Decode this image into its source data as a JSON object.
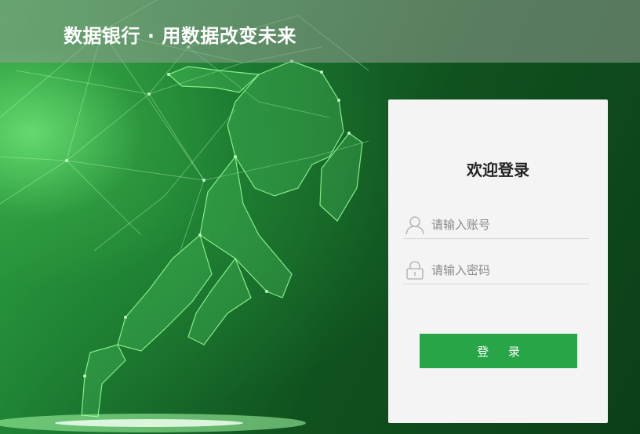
{
  "header": {
    "title": "数据银行 · 用数据改变未来"
  },
  "login": {
    "title": "欢迎登录",
    "account": {
      "placeholder": "请输入账号",
      "value": "",
      "icon": "user-icon"
    },
    "password": {
      "placeholder": "请输入密码",
      "value": "",
      "icon": "lock-icon"
    },
    "submit_label": "登 录"
  },
  "colors": {
    "accent": "#27a547",
    "background_dark": "#0c3f18",
    "panel_bg": "#f4f4f5"
  }
}
